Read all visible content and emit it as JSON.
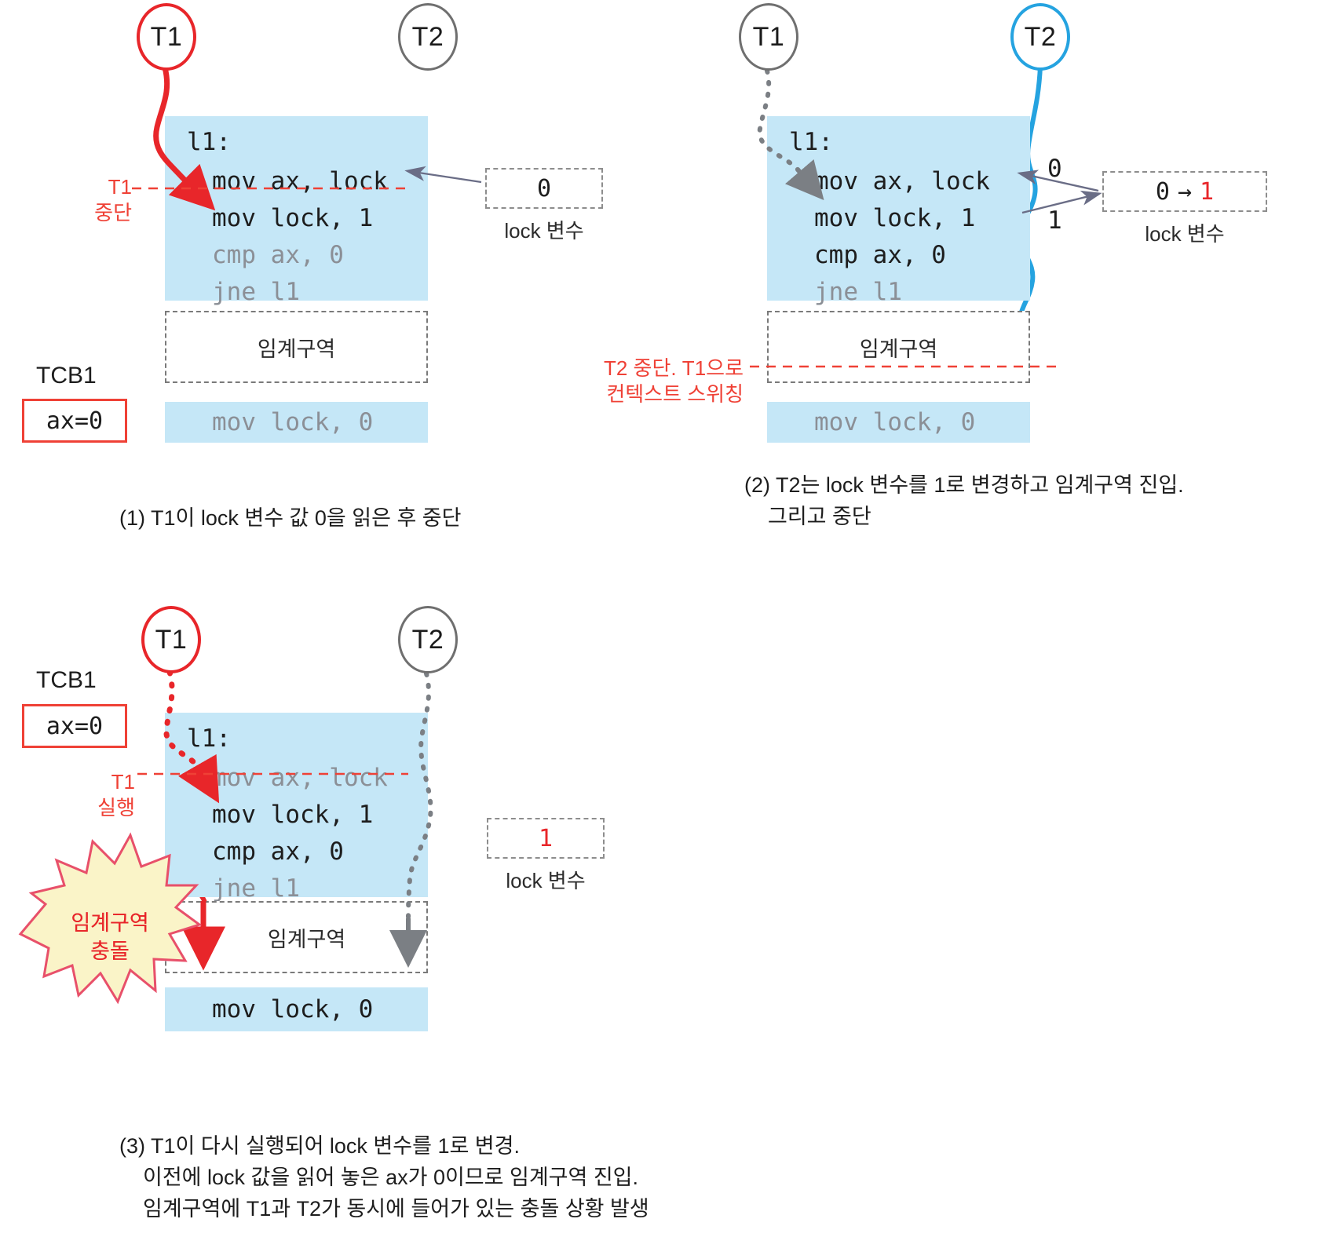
{
  "code": {
    "label": "l1:",
    "lines": [
      "mov ax, lock",
      "mov lock, 1",
      "cmp ax, 0",
      "jne l1"
    ],
    "release": "mov lock, 0"
  },
  "labels": {
    "critical_section": "임계구역",
    "lock_variable": "lock 변수",
    "tcb1": "TCB1",
    "ax_value": "ax=0",
    "thread1": "T1",
    "thread2": "T2"
  },
  "panel1": {
    "node_t1": "T1",
    "node_t2": "T2",
    "code_label": "l1:",
    "code_lines": [
      "mov ax, lock",
      "mov lock, 1",
      "cmp ax, 0",
      "jne l1"
    ],
    "critical_section": "임계구역",
    "release_line": "mov lock, 0",
    "tcb_label": "TCB1",
    "tcb_value": "ax=0",
    "annotation": "T1\n중단",
    "lock_value": "0",
    "lock_caption": "lock 변수",
    "caption": "(1) T1이 lock 변수 값 0을 읽은 후 중단"
  },
  "panel2": {
    "node_t1": "T1",
    "node_t2": "T2",
    "code_label": "l1:",
    "code_lines": [
      "mov ax, lock",
      "mov lock, 1",
      "cmp ax, 0",
      "jne l1"
    ],
    "critical_section": "임계구역",
    "release_line": "mov lock, 0",
    "read_value": "0",
    "write_value": "1",
    "lock_value_old": "0",
    "lock_value_arrow": "→",
    "lock_value_new": "1",
    "lock_caption": "lock 변수",
    "annotation": "T2 중단. T1으로\n컨텍스트 스위칭",
    "caption": "(2) T2는 lock 변수를 1로 변경하고 임계구역 진입.\n    그리고 중단"
  },
  "panel3": {
    "node_t1": "T1",
    "node_t2": "T2",
    "tcb_label": "TCB1",
    "tcb_value": "ax=0",
    "code_label": "l1:",
    "code_lines": [
      "mov ax, lock",
      "mov lock, 1",
      "cmp ax, 0",
      "jne l1"
    ],
    "critical_section": "임계구역",
    "release_line": "mov lock, 0",
    "annotation": "T1\n실행",
    "burst_text": "임계구역\n충돌",
    "lock_value": "1",
    "lock_caption": "lock 변수",
    "caption": "(3) T1이 다시 실행되어 lock 변수를 1로 변경.\n    이전에 lock 값을 읽어 놓은 ax가 0이므로 임계구역 진입.\n    임계구역에 T1과 T2가 동시에 들어가 있는 충돌 상황 발생"
  },
  "colors": {
    "thread1": "#e8262a",
    "thread2_active": "#25a3e0",
    "thread_inactive": "#6f6f6f",
    "code_background": "#c5e7f7",
    "annotation_red": "#ef4136",
    "burst_fill": "#faf4c8",
    "arrow_gray": "#6a6d86"
  }
}
